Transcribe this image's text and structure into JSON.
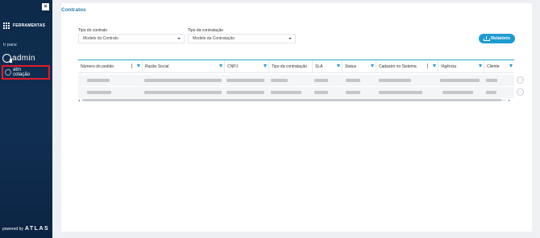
{
  "sidebar": {
    "close_icon": "×",
    "tools_label": "FERRAMENTAS",
    "ir_para": "Ir para:",
    "apps": [
      {
        "name": "admin",
        "icon": "admin-logo-icon"
      },
      {
        "line1": "atm",
        "line2": "cotação",
        "icon": "cotacao-logo-icon",
        "highlight_color": "#e11b2a"
      }
    ],
    "powered_by": "powered by",
    "brand": "ATLAS"
  },
  "main": {
    "title": "Contratos",
    "filters": [
      {
        "label": "Tipo do contrato",
        "value": "Modelo do Contrato"
      },
      {
        "label": "Tipo da contratação",
        "value": "Modelo da Contratação"
      }
    ],
    "report_button": "Relatório",
    "table": {
      "columns": [
        "Número do pedido",
        "Razão Social",
        "CNPJ",
        "Tipo da contratação",
        "SLA",
        "Status",
        "Cadastro no Sistema",
        "Vigência",
        "Cliente"
      ],
      "row_count": 2
    }
  },
  "colors": {
    "sidebar_bg": "#0d2a4a",
    "accent": "#1d9bd1",
    "title": "#2f7fa8",
    "highlight": "#e11b2a"
  }
}
